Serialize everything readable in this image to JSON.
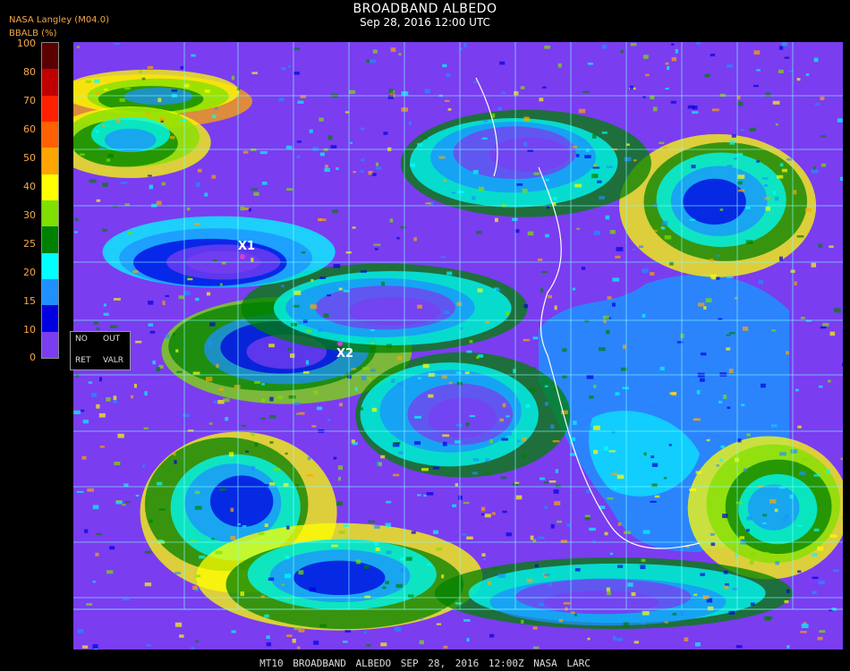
{
  "header": {
    "title": "BROADBAND ALBEDO",
    "datetime": "Sep 28, 2016 12:00 UTC",
    "org": "NASA Langley (M04.0)",
    "unit": "BBALB (%)"
  },
  "colorbar": {
    "ticks": [
      "100",
      "80",
      "70",
      "60",
      "50",
      "40",
      "30",
      "25",
      "20",
      "15",
      "10",
      "0"
    ],
    "colors": [
      "#5a0000",
      "#c00000",
      "#ff2000",
      "#ff6000",
      "#ffa500",
      "#ffff00",
      "#7fe000",
      "#008000",
      "#00ffff",
      "#1e90ff",
      "#0000e0",
      "#7a3df0"
    ]
  },
  "legend_box": {
    "no": "NO",
    "out": "OUT",
    "ret": "RET",
    "valr": "VALR"
  },
  "markers": {
    "x1": "X1",
    "x2": "X2"
  },
  "footer": "MT10  BROADBAND ALBEDO   SEP 28, 2016 12:00Z   NASA LARC",
  "map_palette": {
    "background": "#7a3df0",
    "grid": "#7fffff",
    "coast": "#ffffff"
  }
}
